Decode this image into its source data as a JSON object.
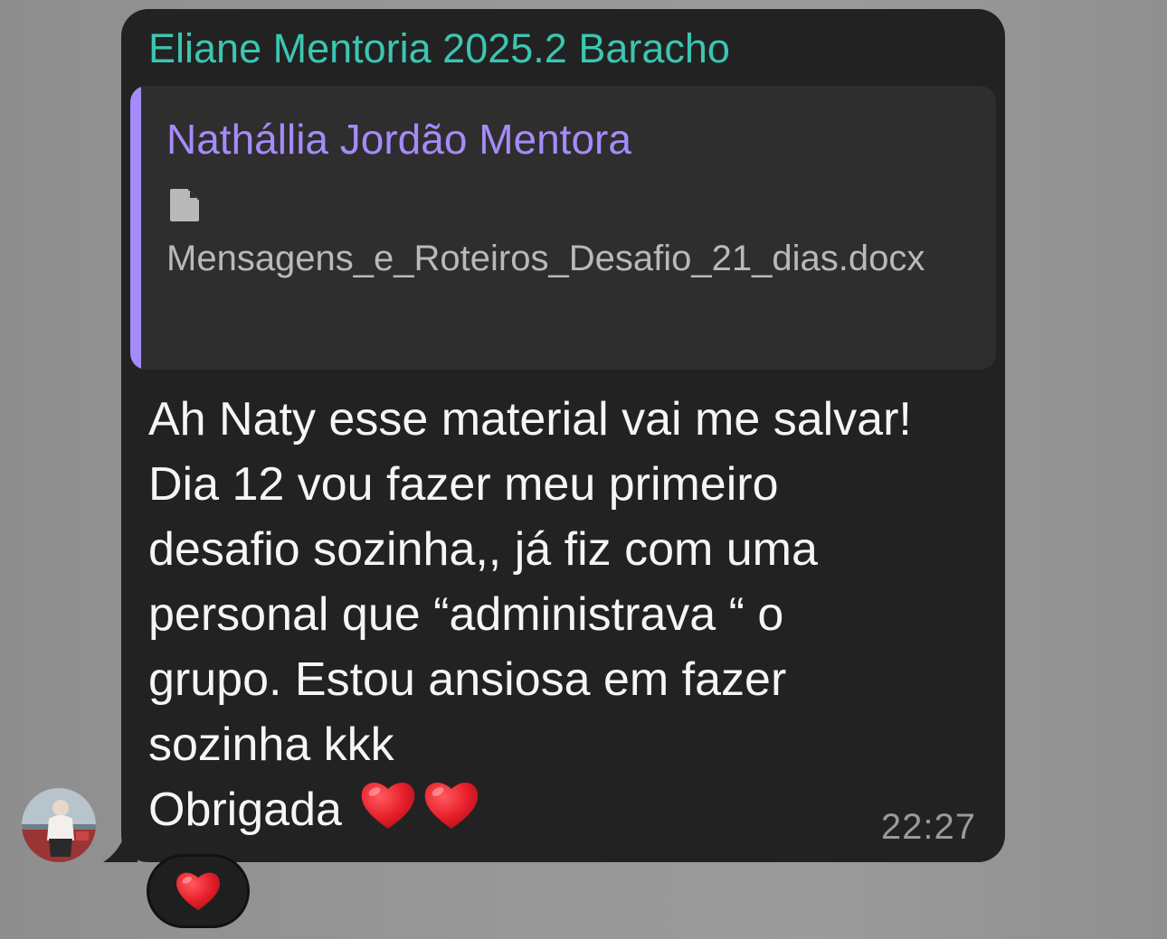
{
  "message": {
    "sender": "Eliane Mentoria 2025.2 Baracho",
    "reply": {
      "author": "Nathállia Jordão Mentora",
      "attachment_icon": "document-icon",
      "file_name": "Mensagens_e_Roteiros_Desafio_21_dias.docx"
    },
    "text": "Ah Naty esse material vai me salvar!\nDia 12 vou fazer meu primeiro\ndesafio sozinha,, já fiz com uma\npersonal que “administrava “ o\ngrupo. Estou ansiosa em fazer\nsozinha kkk\nObrigada",
    "emoji": [
      "heart",
      "heart"
    ],
    "time": "22:27"
  },
  "reaction": {
    "emoji": "heart",
    "count": 1
  },
  "colors": {
    "sender_name": "#3cc5b3",
    "reply_accent": "#a58bfa",
    "bubble_bg": "#222222",
    "heart": "#e8202b"
  }
}
